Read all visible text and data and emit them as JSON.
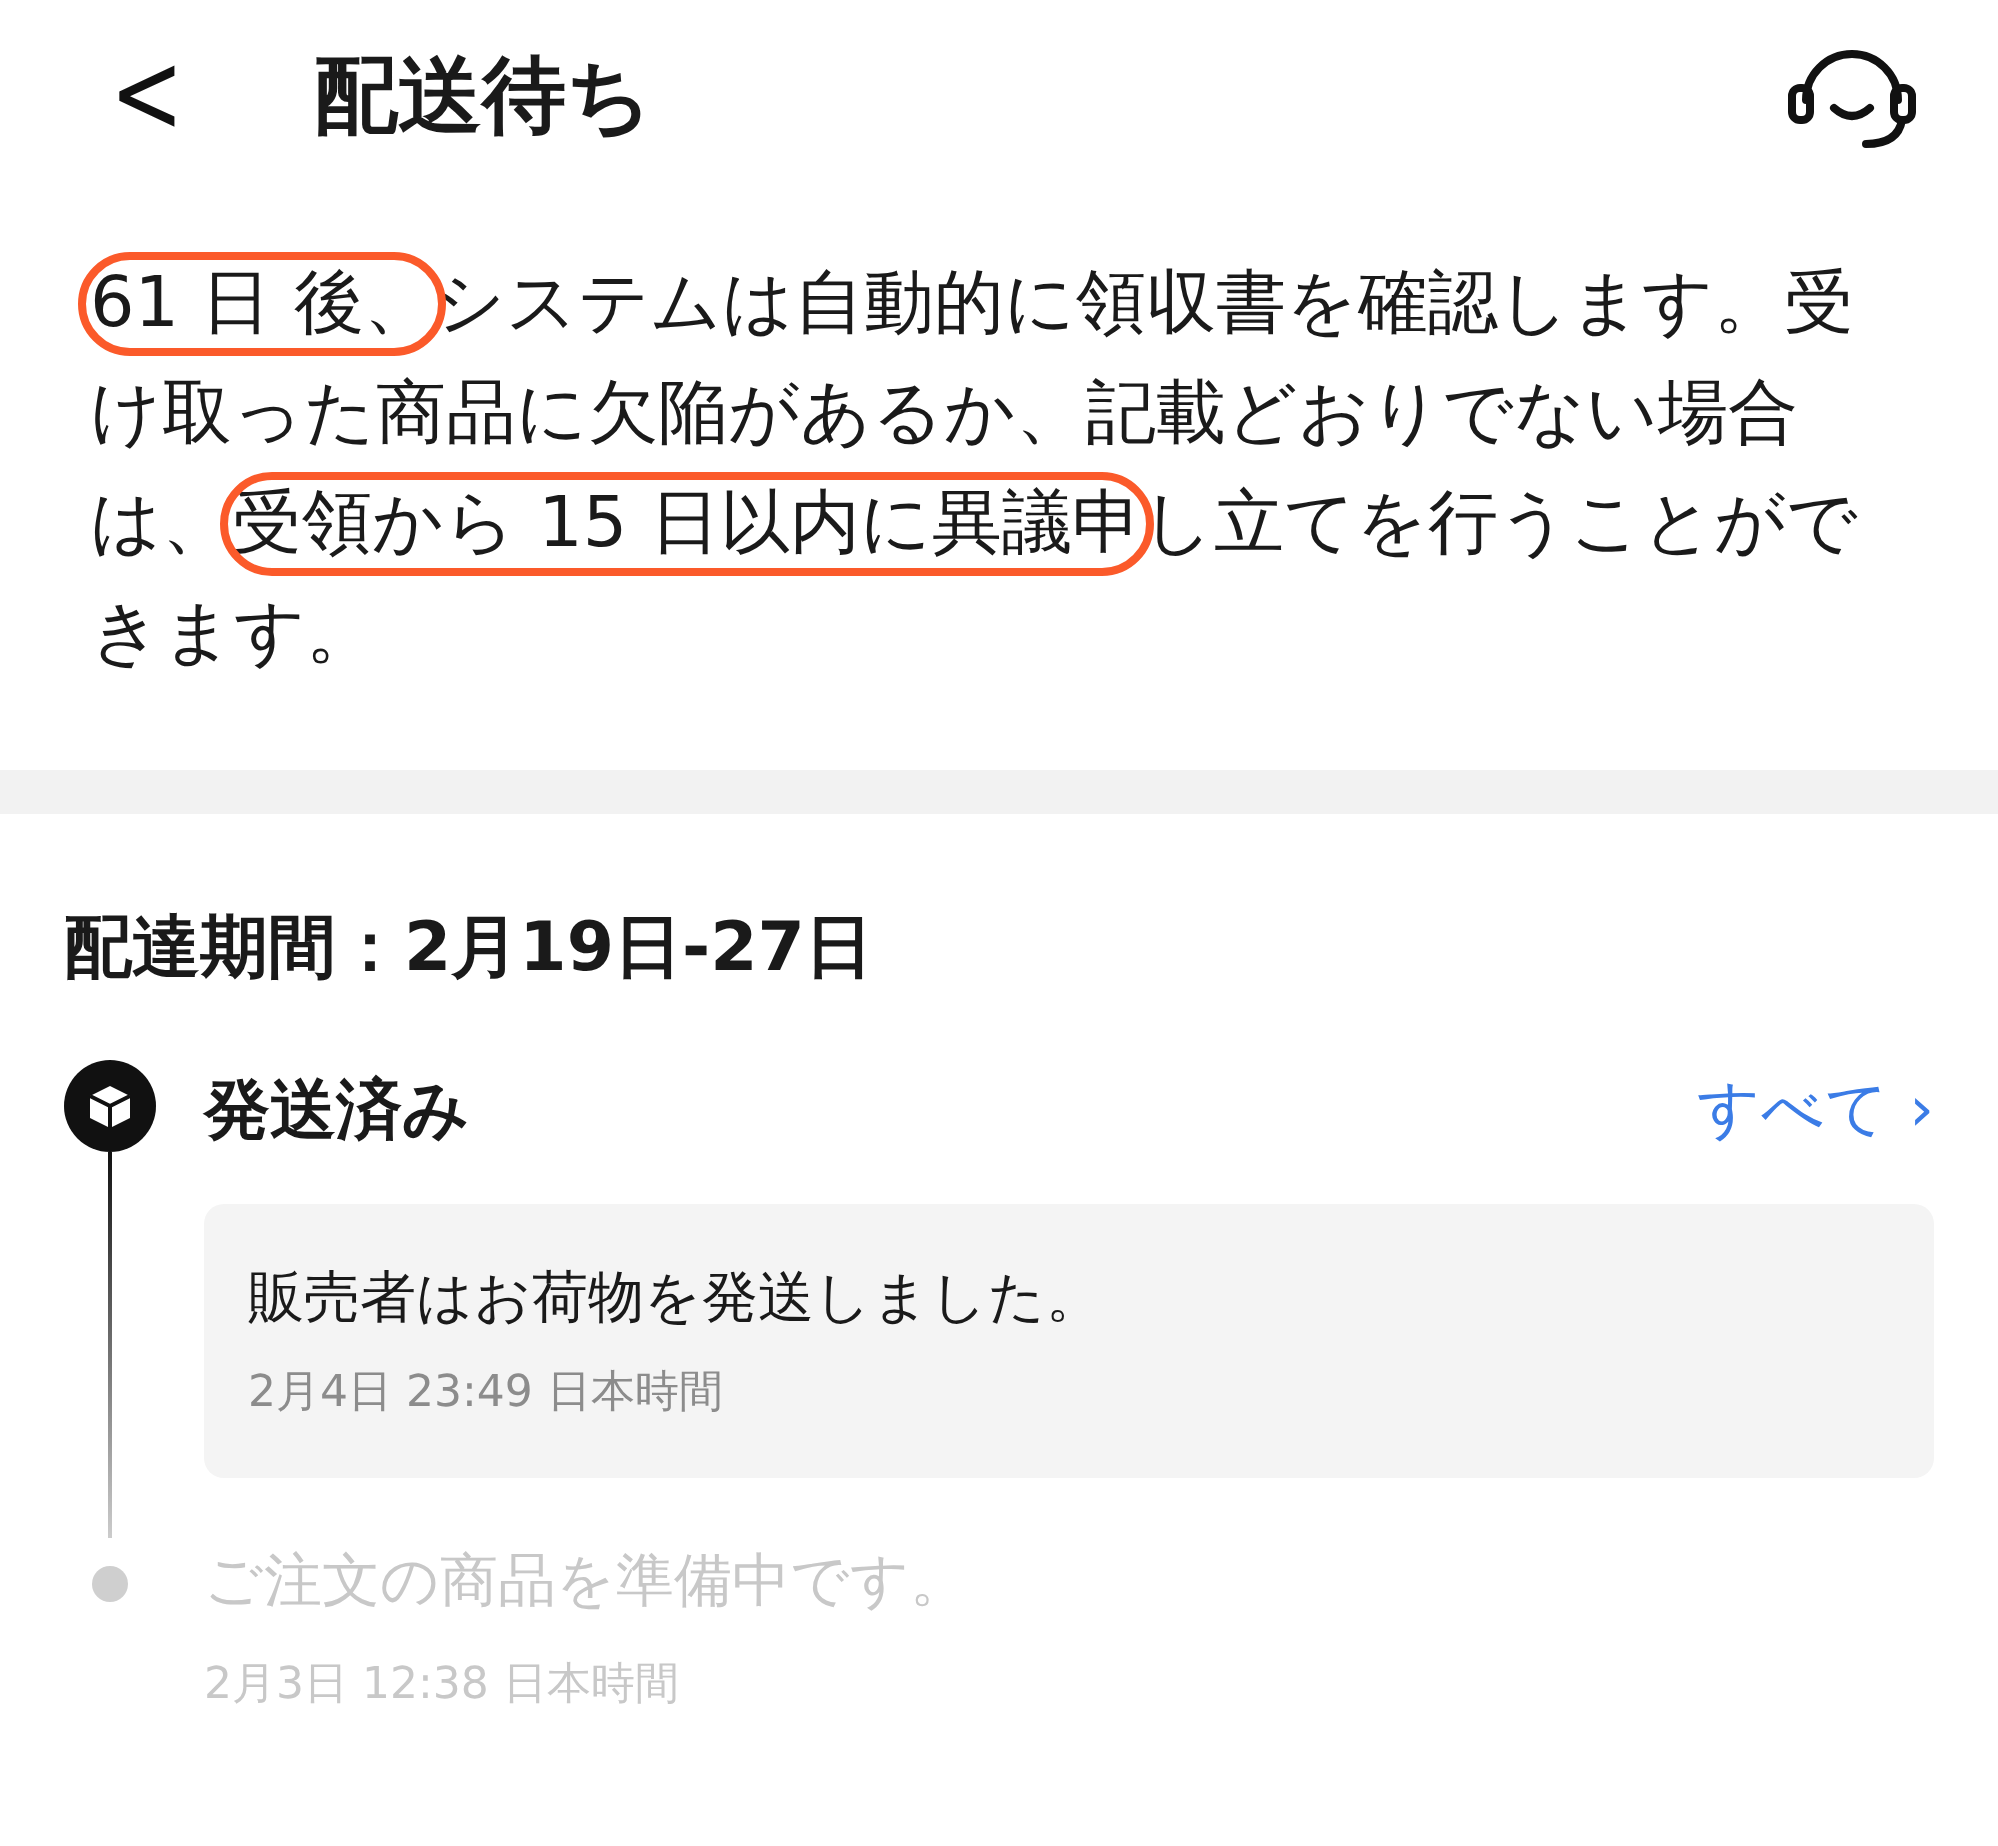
{
  "header": {
    "back": "<",
    "title": "配送待ち"
  },
  "notice": [
    {
      "text": "61 日 後、",
      "circled": true
    },
    {
      "text": "システムは自動的に領収書を確認します。受け取った商品に欠陥があるか、記載どおりでない場合は、",
      "circled": false
    },
    {
      "text": "受領から 15 日以内に異議申",
      "circled": true
    },
    {
      "text": "し立てを行うことができます。",
      "circled": false
    }
  ],
  "delivery_period": "配達期間：2月19日-27日",
  "timeline": [
    {
      "current": true,
      "title": "発送済み",
      "link": "すべて ›",
      "detail": "販売者はお荷物を発送しました。",
      "time": "2月4日 23:49 日本時間"
    },
    {
      "current": false,
      "title": "ご注文の商品を準備中です。",
      "time": "2月3日 12:38 日本時間"
    }
  ]
}
